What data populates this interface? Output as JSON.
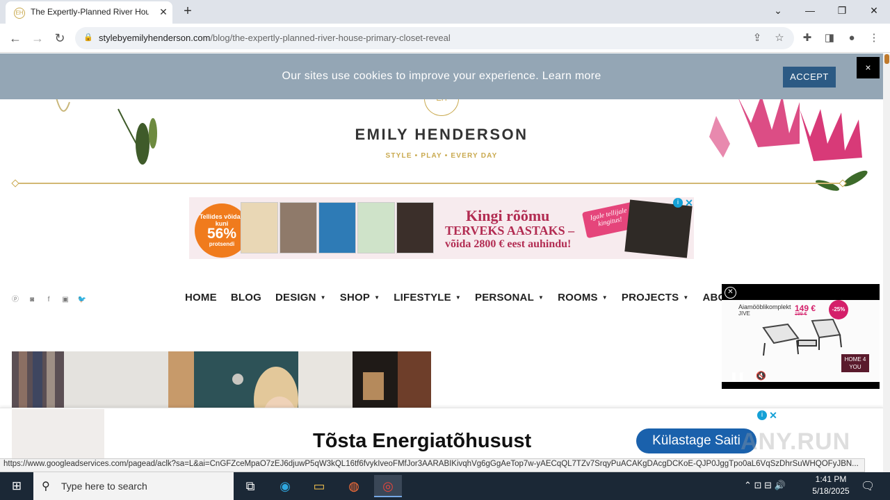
{
  "browser": {
    "tab_title": "The Expertly-Planned River Hou",
    "url_domain": "stylebyemilyhenderson.com",
    "url_path": "/blog/the-expertly-planned-river-house-primary-closet-reveal",
    "status_url": "https://www.googleadservices.com/pagead/aclk?sa=L&ai=CnGFZceMpaO7zEJ6djuwP5qW3kQL16tf6fvykIveoFMfJor3AARABIKivqhVg6gGgAeTop7w-yAECqQL7TZv7SrqyPuACAKgDAcgDCKoE-QJP0JggTpo0aL6VqSzDhrSuWHQOFyJBN..."
  },
  "cookie": {
    "text": "Our sites use cookies to improve your experience. Learn more",
    "accept_label": "ACCEPT",
    "close_label": "×"
  },
  "header": {
    "logo_mark": "EH",
    "logo_name": "EMILY HENDERSON",
    "tagline": "STYLE  •  PLAY  •  EVERY DAY"
  },
  "ad_banner": {
    "badge_line1": "Tellides võidad kuni",
    "badge_percent": "56%",
    "badge_line3": "protsendi",
    "headline": "Kingi rõõmu",
    "line2": "TERVEKS AASTAKS –",
    "line3": "võida 2800 € eest auhindu!",
    "tag": "Igale tellijale kingitus!"
  },
  "nav": {
    "items": [
      {
        "label": "HOME",
        "dropdown": false
      },
      {
        "label": "BLOG",
        "dropdown": false
      },
      {
        "label": "DESIGN",
        "dropdown": true
      },
      {
        "label": "SHOP",
        "dropdown": true
      },
      {
        "label": "LIFESTYLE",
        "dropdown": true
      },
      {
        "label": "PERSONAL",
        "dropdown": true
      },
      {
        "label": "ROOMS",
        "dropdown": true
      },
      {
        "label": "PROJECTS",
        "dropdown": true
      },
      {
        "label": "ABO",
        "dropdown": false
      }
    ],
    "social": [
      "pinterest-icon",
      "instagram-icon",
      "facebook-icon",
      "youtube-icon",
      "twitter-icon"
    ]
  },
  "video_ad": {
    "brand": "Aiamööblikomplekt",
    "brand2": "JIVE",
    "price": "149 €",
    "old_price": "199 €",
    "discount": "-25%",
    "logo": "HOME 4 YOU"
  },
  "bottom_ad": {
    "text": "Tõsta Energiatõhusust",
    "cta": "Külastage Saiti",
    "watermark": "ANY.RUN"
  },
  "taskbar": {
    "search_placeholder": "Type here to search",
    "time": "1:41 PM",
    "date": "5/18/2025"
  }
}
